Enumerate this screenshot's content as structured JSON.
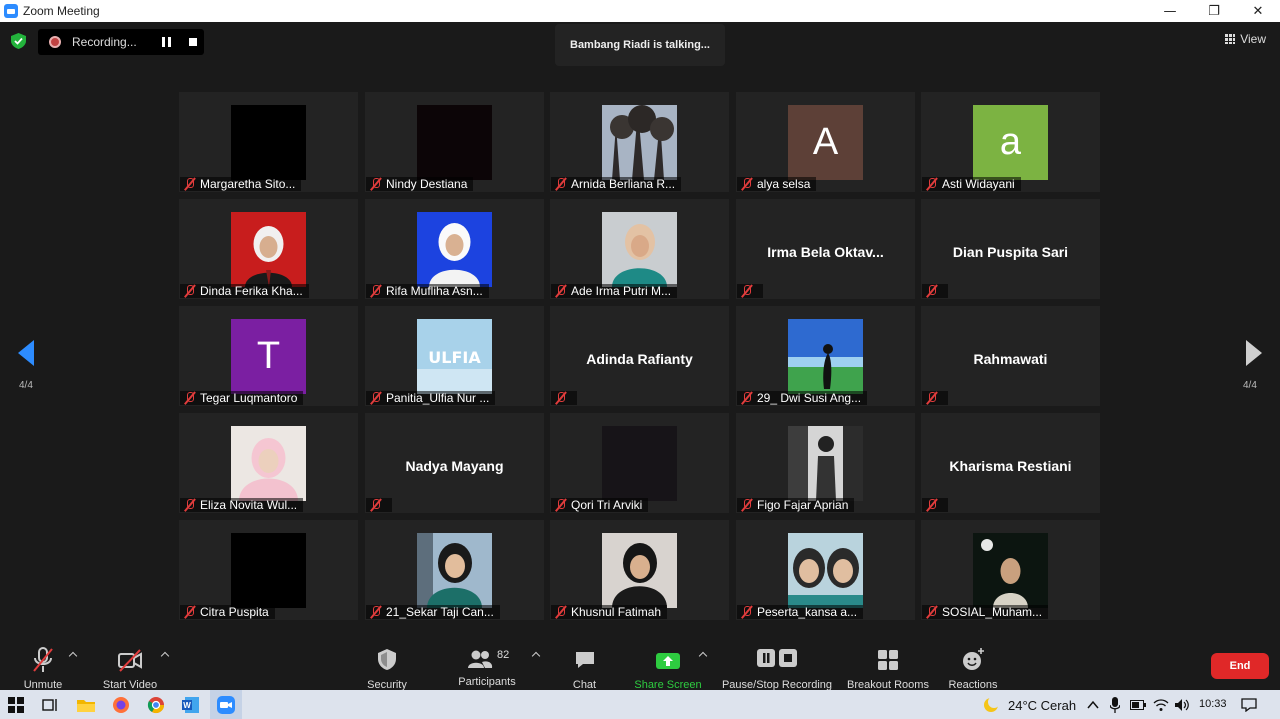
{
  "window": {
    "title": "Zoom Meeting",
    "controls": [
      "—",
      "❐",
      "✕"
    ]
  },
  "header": {
    "recording_label": "Recording...",
    "talking_text": "Bambang Riadi is talking...",
    "view_label": "View"
  },
  "pagination": {
    "left_page": "4/4",
    "right_page": "4/4"
  },
  "participants": [
    {
      "name": "Margaretha Sito...",
      "show": "video",
      "bg": "#000000"
    },
    {
      "name": "Nindy Destiana",
      "show": "video",
      "bg": "#0c0507"
    },
    {
      "name": "Arnida Berliana R...",
      "show": "photo",
      "bg": "#5a6577",
      "photo": "trees"
    },
    {
      "name": "alya selsa",
      "show": "letter",
      "bg": "#5d4037",
      "letter": "A"
    },
    {
      "name": "Asti Widayani",
      "show": "letter",
      "bg": "#7cb342",
      "letter": "a"
    },
    {
      "name": "Dinda Ferika Kha...",
      "show": "photo",
      "bg": "#c81d1d",
      "photo": "person-red"
    },
    {
      "name": "Rifa Mufliha Asn...",
      "show": "photo",
      "bg": "#1c43e0",
      "photo": "person-blue"
    },
    {
      "name": "Ade Irma Putri M...",
      "show": "photo",
      "bg": "#c9cdd0",
      "photo": "person-light"
    },
    {
      "name": "",
      "show": "bigname",
      "big": "Irma  Bela  Oktav..."
    },
    {
      "name": "",
      "show": "bigname",
      "big": "Dian Puspita Sari"
    },
    {
      "name": "Tegar Luqmantoro",
      "show": "letter",
      "bg": "#7b1fa2",
      "letter": "T"
    },
    {
      "name": "Panitia_Ulfia Nur ...",
      "show": "photo",
      "bg": "#a8d2ea",
      "photo": "ulfia"
    },
    {
      "name": "",
      "show": "bigname",
      "big": "Adinda Rafianty"
    },
    {
      "name": "29_ Dwi Susi Ang...",
      "show": "photo",
      "bg": "#3a7bd5",
      "photo": "landscape"
    },
    {
      "name": "",
      "show": "bigname",
      "big": "Rahmawati"
    },
    {
      "name": "Eliza Novita Wul...",
      "show": "photo",
      "bg": "#ece7e3",
      "photo": "person-pink"
    },
    {
      "name": "",
      "show": "bigname",
      "big": "Nadya Mayang"
    },
    {
      "name": "Qori Tri Arviki",
      "show": "video",
      "bg": "#171418"
    },
    {
      "name": "Figo Fajar Aprian",
      "show": "photo",
      "bg": "#9a9a9a",
      "photo": "bw"
    },
    {
      "name": "",
      "show": "bigname",
      "big": "Kharisma Restiani"
    },
    {
      "name": "Citra Puspita",
      "show": "video",
      "bg": "#000000"
    },
    {
      "name": "21_Sekar Taji Can...",
      "show": "photo",
      "bg": "#8aa8c0",
      "photo": "person-hijab"
    },
    {
      "name": "Khusnul Fatimah",
      "show": "photo",
      "bg": "#d8d3cf",
      "photo": "person-dark"
    },
    {
      "name": "Peserta_kansa a...",
      "show": "photo",
      "bg": "#b9d3dd",
      "photo": "twins"
    },
    {
      "name": "SOSIAL_Muham...",
      "show": "photo",
      "bg": "#0f1a14",
      "photo": "night"
    }
  ],
  "toolbar": {
    "unmute": "Unmute",
    "start_video": "Start Video",
    "security": "Security",
    "participants": "Participants",
    "participants_count": "82",
    "chat": "Chat",
    "share_screen": "Share Screen",
    "pause_stop_recording": "Pause/Stop Recording",
    "breakout_rooms": "Breakout Rooms",
    "reactions": "Reactions",
    "end": "End"
  },
  "taskbar": {
    "weather": "24°C  Cerah",
    "time": "10:33"
  },
  "colors": {
    "accent": "#2d8cff",
    "share_green": "#2ecc40",
    "end_red": "#e02828",
    "mic_off_red": "#e03c3c"
  }
}
